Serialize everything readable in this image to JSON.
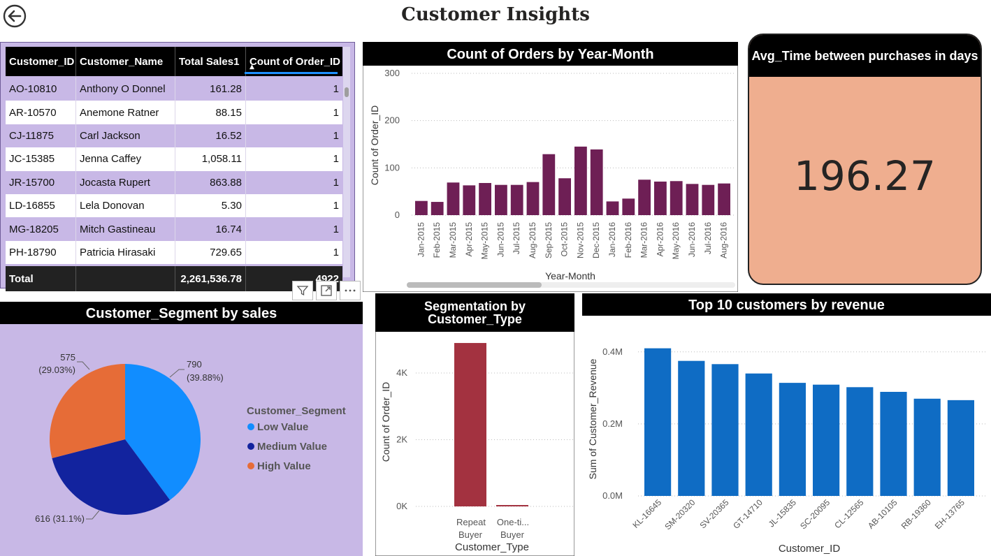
{
  "page": {
    "title": "Customer Insights"
  },
  "table": {
    "headers": [
      "Customer_ID",
      "Customer_Name",
      "Total Sales1",
      "Count of Order_ID"
    ],
    "rows": [
      [
        "AO-10810",
        "Anthony O Donnel",
        "161.28",
        "1"
      ],
      [
        "AR-10570",
        "Anemone Ratner",
        "88.15",
        "1"
      ],
      [
        "CJ-11875",
        "Carl Jackson",
        "16.52",
        "1"
      ],
      [
        "JC-15385",
        "Jenna Caffey",
        "1,058.11",
        "1"
      ],
      [
        "JR-15700",
        "Jocasta Rupert",
        "863.88",
        "1"
      ],
      [
        "LD-16855",
        "Lela Donovan",
        "5.30",
        "1"
      ],
      [
        "MG-18205",
        "Mitch Gastineau",
        "16.74",
        "1"
      ],
      [
        "PH-18790",
        "Patricia Hirasaki",
        "729.65",
        "1"
      ]
    ],
    "total": {
      "label": "Total",
      "sales": "2,261,536.78",
      "count": "4922"
    }
  },
  "kpi": {
    "title": "Avg_Time between purchases in days",
    "value": "196.27"
  },
  "colors": {
    "purple_bar": "#6e1f55",
    "segment_bar": "#a33240",
    "revenue_bar": "#0f6cc4",
    "low": "#118dff",
    "medium": "#12239e",
    "high": "#e66c37",
    "kpi_bg": "#efae8f",
    "panel_bg": "#c8b8e6"
  },
  "chart_data": [
    {
      "type": "bar",
      "title": "Count of Orders by Year-Month",
      "xlabel": "Year-Month",
      "ylabel": "Count of Order_ID",
      "ylim": [
        0,
        300
      ],
      "yticks": [
        "0",
        "100",
        "200",
        "300"
      ],
      "categories": [
        "Jan-2015",
        "Feb-2015",
        "Mar-2015",
        "Apr-2015",
        "May-2015",
        "Jun-2015",
        "Jul-2015",
        "Aug-2015",
        "Sep-2015",
        "Oct-2015",
        "Nov-2015",
        "Dec-2015",
        "Jan-2016",
        "Feb-2016",
        "Mar-2016",
        "Apr-2016",
        "May-2016",
        "Jun-2016",
        "Jul-2016",
        "Aug-2016"
      ],
      "values": [
        30,
        28,
        69,
        63,
        68,
        64,
        64,
        70,
        129,
        78,
        145,
        139,
        29,
        35,
        75,
        71,
        72,
        66,
        64,
        67
      ],
      "grid": true
    },
    {
      "type": "bar",
      "title": "Segmentation by Customer_Type",
      "xlabel": "Customer_Type",
      "ylabel": "Count of Order_ID",
      "ylim": [
        0,
        4922
      ],
      "yticks": [
        "0K",
        "2K",
        "4K"
      ],
      "categories": [
        [
          "Repeat",
          "Buyer"
        ],
        [
          "One-ti...",
          "Buyer"
        ]
      ],
      "values": [
        4900,
        22
      ],
      "grid": true
    },
    {
      "type": "bar",
      "title": "Top 10 customers by revenue",
      "xlabel": "Customer_ID",
      "ylabel": "Sum of Customer_Revenue",
      "ylim": [
        0,
        450000
      ],
      "yticks": [
        "0.0M",
        "0.2M",
        "0.4M"
      ],
      "categories": [
        "KL-16645",
        "SM-20320",
        "SV-20365",
        "GT-14710",
        "JL-15835",
        "SC-20095",
        "CL-12565",
        "AB-10105",
        "RB-19360",
        "EH-13765"
      ],
      "values": [
        410000,
        375000,
        366000,
        340000,
        314000,
        309000,
        302000,
        289000,
        270000,
        266000
      ],
      "grid": true
    },
    {
      "type": "pie",
      "title": "Customer_Segment by sales",
      "legend_title": "Customer_Segment",
      "legend": "right",
      "slices": [
        {
          "name": "Low Value",
          "value": 790,
          "label": "790",
          "pct": "(39.88%)"
        },
        {
          "name": "Medium Value",
          "value": 616,
          "label": "616 (31.1%)",
          "pct": ""
        },
        {
          "name": "High Value",
          "value": 575,
          "label": "575",
          "pct": "(29.03%)"
        }
      ]
    }
  ]
}
